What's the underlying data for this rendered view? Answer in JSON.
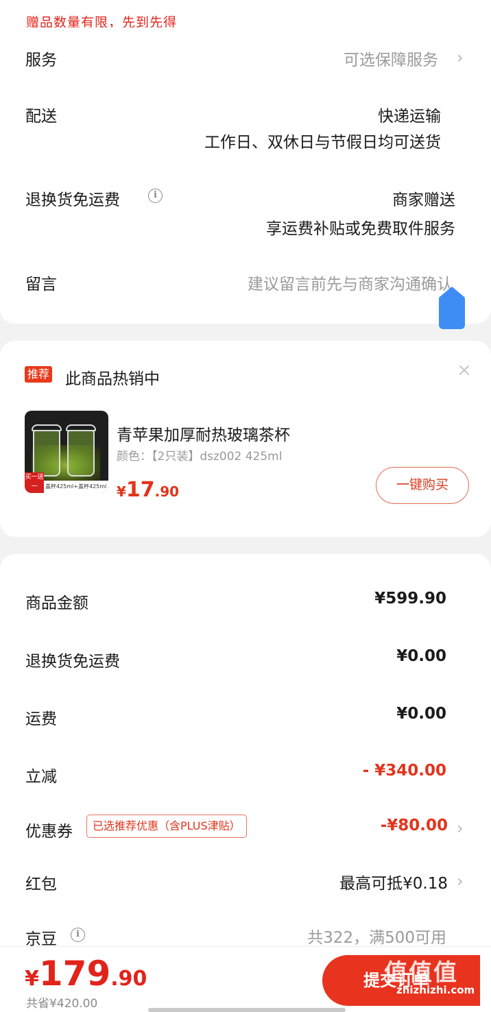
{
  "notice": "赠品数量有限，先到先得",
  "service": {
    "label": "服务",
    "value": "可选保障服务"
  },
  "delivery": {
    "label": "配送",
    "line1": "快递运输",
    "line2": "工作日、双休日与节假日均可送货"
  },
  "return_free": {
    "label": "退换货免运费",
    "line1": "商家赠送",
    "line2": "享运费补贴或免费取件服务"
  },
  "message": {
    "label": "留言",
    "placeholder": "建议留言前先与商家沟通确认"
  },
  "recommend": {
    "tag": "推荐",
    "title": "此商品热销中",
    "close": "×",
    "product_name": "青苹果加厚耐热玻璃茶杯",
    "spec": "颜色：【2只装】dsz002 425ml",
    "price_symbol": "¥",
    "price_int": "17",
    "price_dec": ".90",
    "buy_label": "一键购买",
    "thumb_badge": "买一送一",
    "thumb_caption": "盖杯425ml+盖杯425ml"
  },
  "summary": {
    "goods_amount": {
      "label": "商品金额",
      "value": "¥599.90"
    },
    "return_fee": {
      "label": "退换货免运费",
      "value": "¥0.00"
    },
    "shipping": {
      "label": "运费",
      "value": "¥0.00"
    },
    "discount": {
      "label": "立减",
      "value": "- ¥340.00"
    },
    "coupon": {
      "label": "优惠券",
      "tag": "已选推荐优惠（含PLUS津贴）",
      "value": "-¥80.00"
    },
    "red_packet": {
      "label": "红包",
      "value": "最高可抵¥0.18"
    },
    "jd_beans": {
      "label": "京豆",
      "value": "共322，满500可用"
    }
  },
  "bottom": {
    "total_symbol": "¥",
    "total_int": "179",
    "total_dec": ".90",
    "saved": "共省¥420.00",
    "submit": "提交订单",
    "watermark": "值值值",
    "watermark_url": "zhizhizhi.com"
  },
  "colors": {
    "accent": "#e2341d",
    "blue_button": "#3e8df5"
  }
}
